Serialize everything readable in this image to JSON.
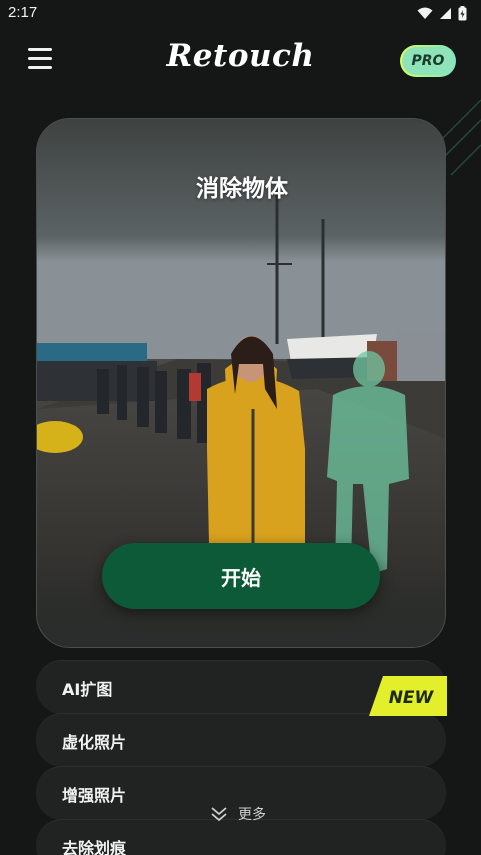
{
  "status_bar": {
    "time": "2:17"
  },
  "header": {
    "app_name": "Retouch",
    "pro_label": "PRO"
  },
  "hero": {
    "title": "消除物体",
    "start_button": "开始"
  },
  "features": [
    {
      "label": "AI扩图"
    },
    {
      "label": "虚化照片"
    },
    {
      "label": "增强照片"
    },
    {
      "label": "去除划痕"
    }
  ],
  "badge": {
    "new_label": "NEW"
  },
  "more": {
    "label": "更多"
  },
  "colors": {
    "accent_green": "#0d5a38",
    "pro_gradient_start": "#d8ff5a",
    "pro_gradient_end": "#7ce6c4",
    "new_badge": "#e3ef2a"
  },
  "icons": [
    "wifi-icon",
    "signal-icon",
    "battery-icon",
    "menu-icon",
    "chevron-double-down-icon"
  ]
}
